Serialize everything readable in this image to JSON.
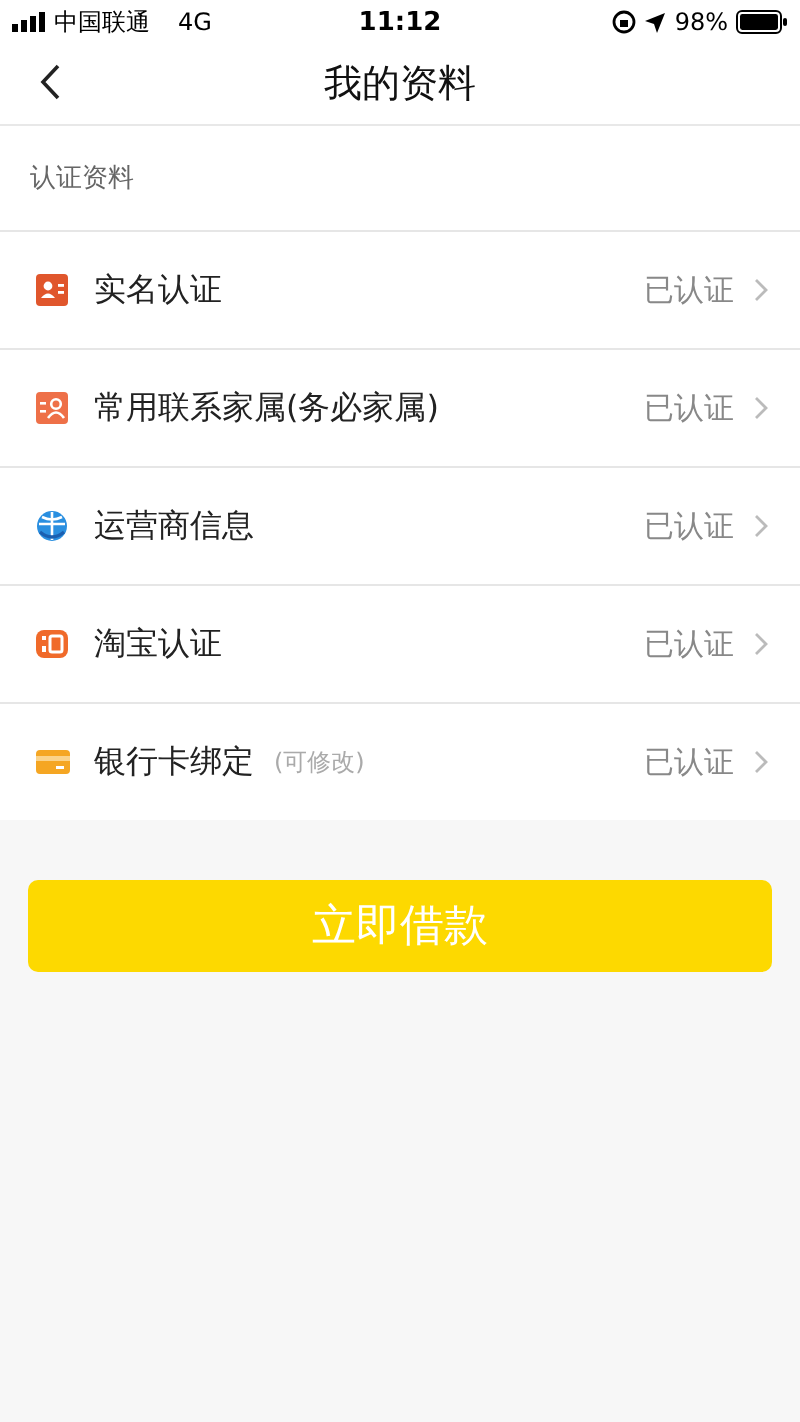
{
  "status_bar": {
    "carrier": "中国联通",
    "network": "4G",
    "time": "11:12",
    "battery": "98%"
  },
  "nav": {
    "title": "我的资料"
  },
  "section": {
    "title": "认证资料"
  },
  "items": [
    {
      "kind": "id",
      "label": "实名认证",
      "status": "已认证"
    },
    {
      "kind": "contacts",
      "label": "常用联系家属(务必家属)",
      "status": "已认证"
    },
    {
      "kind": "carrier",
      "label": "运营商信息",
      "status": "已认证"
    },
    {
      "kind": "shop",
      "label": "淘宝认证",
      "status": "已认证"
    },
    {
      "kind": "card",
      "label": "银行卡绑定",
      "note": "(可修改)",
      "status": "已认证"
    }
  ],
  "primary_button": "立即借款"
}
